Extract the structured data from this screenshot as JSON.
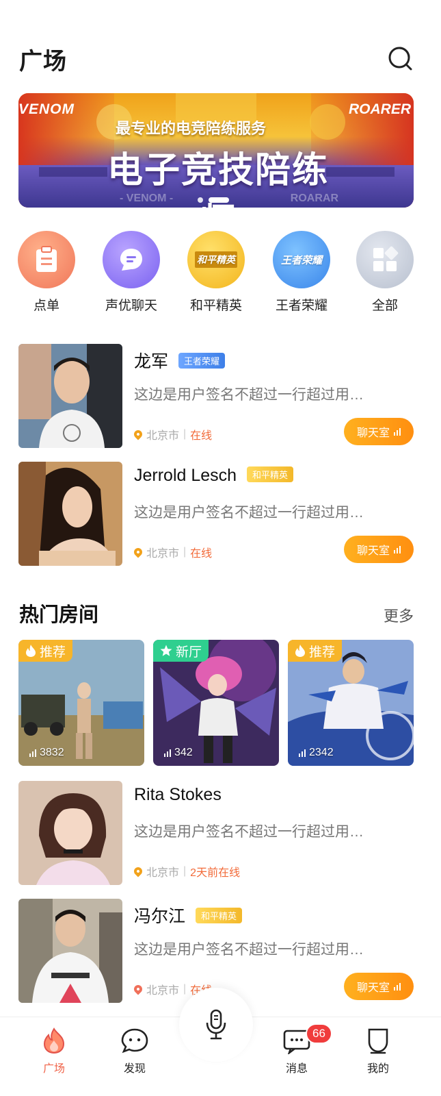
{
  "header": {
    "title": "广场",
    "search_icon": "search-icon"
  },
  "banner": {
    "subtitle": "最专业的电竞陪练服务",
    "title": "电子竞技陪练师",
    "team_left": "VENOM",
    "team_right": "ROARER",
    "floor_left": "- VENOM -",
    "floor_right": "ROARAR",
    "dots": 2,
    "active_dot": 2
  },
  "categories": [
    {
      "label": "点单",
      "icon": "clipboard-icon",
      "color": "#f0775a"
    },
    {
      "label": "声优聊天",
      "icon": "chat-bubble-icon",
      "color": "#7a62f0"
    },
    {
      "label": "和平精英",
      "icon": "game-logo-icon",
      "mark": "和平精英",
      "color": "#f3b51d"
    },
    {
      "label": "王者荣耀",
      "icon": "game-logo-icon",
      "mark": "王者荣耀",
      "color": "#3a86ea"
    },
    {
      "label": "全部",
      "icon": "grid-icon",
      "color": "#b8c0cf"
    }
  ],
  "users": [
    {
      "name": "龙军",
      "game_tag": "王者荣耀",
      "tag_color": "blue",
      "signature": "这边是用户签名不超过一行超过用…",
      "city": "北京市",
      "status": "在线",
      "chat_label": "聊天室"
    },
    {
      "name": "Jerrold Lesch",
      "game_tag": "和平精英",
      "tag_color": "yellow",
      "signature": "这边是用户签名不超过一行超过用…",
      "city": "北京市",
      "status": "在线",
      "chat_label": "聊天室"
    }
  ],
  "hot_rooms": {
    "title": "热门房间",
    "more": "更多",
    "rooms": [
      {
        "badge": "推荐",
        "badge_icon": "fire-icon",
        "count": "3832"
      },
      {
        "badge": "新厅",
        "badge_icon": "star-icon",
        "count": "342"
      },
      {
        "badge": "推荐",
        "badge_icon": "fire-icon",
        "count": "2342"
      }
    ]
  },
  "users_more": [
    {
      "name": "Rita Stokes",
      "signature": "这边是用户签名不超过一行超过用…",
      "city": "北京市",
      "status": "2天前在线"
    },
    {
      "name": "冯尔江",
      "game_tag": "和平精英",
      "tag_color": "yellow",
      "signature": "这边是用户签名不超过一行超过用…",
      "city": "北京市",
      "status": "在线",
      "chat_label": "聊天室"
    }
  ],
  "tabbar": {
    "tabs": [
      {
        "label": "广场",
        "icon": "flame-icon",
        "active": true
      },
      {
        "label": "发现",
        "icon": "smile-bubble-icon",
        "active": false
      },
      {
        "label": "消息",
        "icon": "message-icon",
        "active": false,
        "badge": "66"
      },
      {
        "label": "我的",
        "icon": "profile-icon",
        "active": false
      }
    ],
    "center_icon": "microphone-icon"
  },
  "colors": {
    "accent": "#ff9a16",
    "online": "#f26b3a",
    "active_tab": "#f0644a",
    "badge": "#f03c3c"
  }
}
